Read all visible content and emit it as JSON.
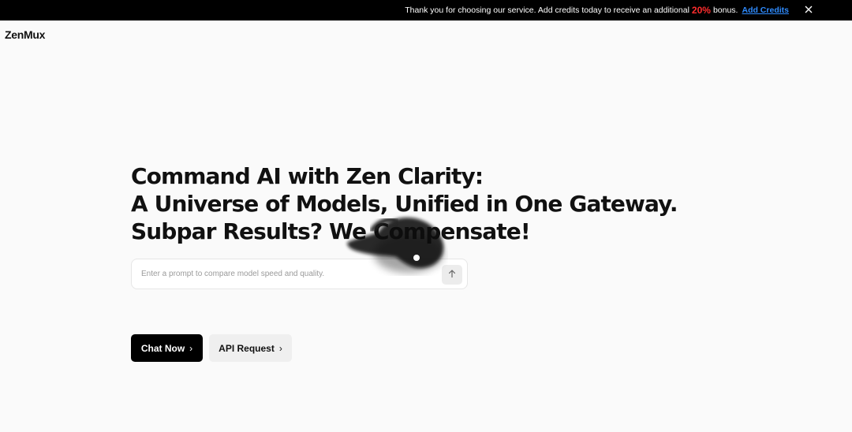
{
  "banner": {
    "message": "Thank you for choosing our service. Add credits today to receive an additional",
    "bonus_percent": "20%",
    "bonus_suffix": "bonus.",
    "cta_label": "Add Credits",
    "close_icon": "close-icon"
  },
  "header": {
    "logo": "ZenMux"
  },
  "hero": {
    "line1": "Command AI with Zen Clarity:",
    "line2": "A Universe of Models, Unified in One Gateway.",
    "line3": "Subpar Results? We Compensate!"
  },
  "prompt": {
    "placeholder": "Enter a prompt to compare model speed and quality.",
    "value": "",
    "send_icon": "arrow-up-icon"
  },
  "actions": {
    "primary_label": "Chat Now",
    "secondary_label": "API Request",
    "chevron_icon": "chevron-right-icon"
  },
  "colors": {
    "banner_bg": "#000000",
    "bonus": "#ff2d2d",
    "link": "#2f8cff",
    "primary_button": "#000000",
    "page_bg": "#fafafa"
  }
}
